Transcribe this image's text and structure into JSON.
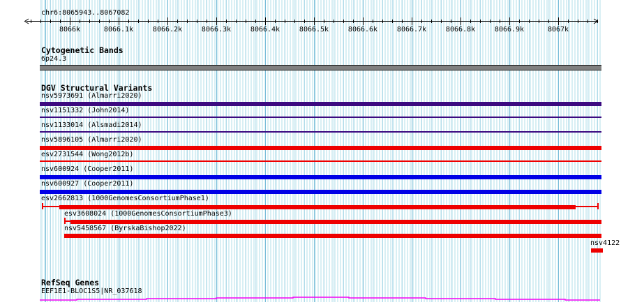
{
  "region": {
    "title": "chr6:8065943..8067082"
  },
  "ruler": {
    "tick_labels": [
      "8066k",
      "8066.1k",
      "8066.2k",
      "8066.3k",
      "8066.4k",
      "8066.5k",
      "8066.6k",
      "8066.7k",
      "8066.8k",
      "8066.9k",
      "8067k"
    ]
  },
  "colors": {
    "grid_major_line": "#79bcd9",
    "grid_stripe": "#d8eff4",
    "variant_gain": "#ee0000",
    "variant_loss": "#0000e6",
    "variant_complex": "#3c0a80",
    "cytoband_fill": "#808080",
    "refseq_gene": "#f400f4"
  },
  "tracks": {
    "cytogenetic_bands": {
      "header": "Cytogenetic Bands",
      "band_label": "6p24.3",
      "band_color": "#808080"
    },
    "dgv_structural_variants": {
      "header": "DGV Structural Variants",
      "variants": [
        {
          "label": "nsv5973691 (Almarri2020)",
          "color": "#3c0a80"
        },
        {
          "label": "nsv1151332 (John2014)",
          "color": "#3c0a80"
        },
        {
          "label": "nsv1133014 (Alsmadi2014)",
          "color": "#3c0a80"
        },
        {
          "label": "nsv5896105 (Almarri2020)",
          "color": "#ee0000"
        },
        {
          "label": "esv2731544 (Wong2012b)",
          "color": "#ee0000"
        },
        {
          "label": "nsv600924 (Cooper2011)",
          "color": "#0000e6"
        },
        {
          "label": "nsv600927 (Cooper2011)",
          "color": "#0000e6"
        },
        {
          "label": "esv2662813 (1000GenomesConsortiumPhase1)",
          "color": "#ee0000"
        },
        {
          "label": "esv3608024 (1000GenomesConsortiumPhase3)",
          "color": "#ee0000"
        },
        {
          "label": "nsv5458567 (ByrskaBishop2022)",
          "color": "#ee0000"
        },
        {
          "label": "nsv4122",
          "color": "#ee0000"
        }
      ]
    },
    "refseq_genes": {
      "header": "RefSeq Genes",
      "gene_label": "EEF1E1-BLOC1S5|NR_037618",
      "gene_color": "#f400f4"
    }
  }
}
